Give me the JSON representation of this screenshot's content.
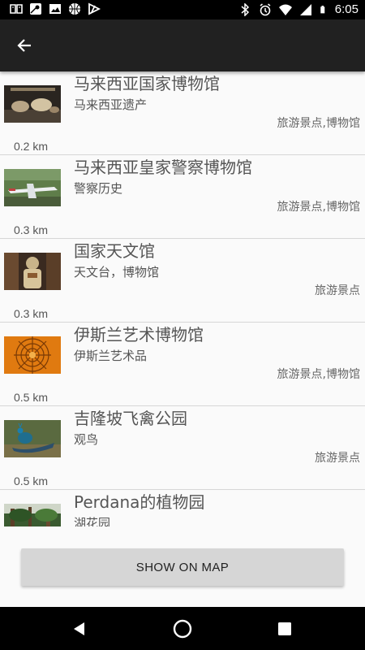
{
  "status_bar": {
    "time": "6:05",
    "left_icons": [
      "ebook-icon",
      "maps-icon",
      "image-icon",
      "basketball-icon",
      "no-signal-icon"
    ],
    "right_icons": [
      "bluetooth-icon",
      "alarm-icon",
      "wifi-icon",
      "signal-icon",
      "battery-icon"
    ]
  },
  "app_bar": {
    "back_icon": "arrow-back-icon"
  },
  "places": [
    {
      "title": "马来西亚国家博物馆",
      "subtitle": "马来西亚遗产",
      "category": "旅游景点,博物馆",
      "distance": "0.2 km",
      "thumbnail": "museum-artifacts"
    },
    {
      "title": "马来西亚皇家警察博物馆",
      "subtitle": "警察历史",
      "category": "旅游景点,博物馆",
      "distance": "0.3 km",
      "thumbnail": "airplane-garden"
    },
    {
      "title": "国家天文馆",
      "subtitle": "天文台，博物馆",
      "category": "旅游景点",
      "distance": "0.3 km",
      "thumbnail": "astronaut-exhibit"
    },
    {
      "title": "伊斯兰艺术博物馆",
      "subtitle": "伊斯兰艺术品",
      "category": "旅游景点,博物馆",
      "distance": "0.5 km",
      "thumbnail": "orange-dome-pattern"
    },
    {
      "title": "吉隆坡飞禽公园",
      "subtitle": "观鸟",
      "category": "旅游景点",
      "distance": "0.5 km",
      "thumbnail": "peacock"
    },
    {
      "title": "Perdana的植物园",
      "subtitle": "湖花园",
      "category": "",
      "distance": "",
      "thumbnail": "garden-trees"
    }
  ],
  "show_on_map_label": "SHOW ON MAP",
  "nav_bar": {
    "back": "nav-back-icon",
    "home": "nav-home-icon",
    "recents": "nav-recents-icon"
  },
  "colors": {
    "app_bar": "#212121",
    "background": "#fafafa",
    "button": "#d6d6d6",
    "divider": "#d6d6d6"
  }
}
